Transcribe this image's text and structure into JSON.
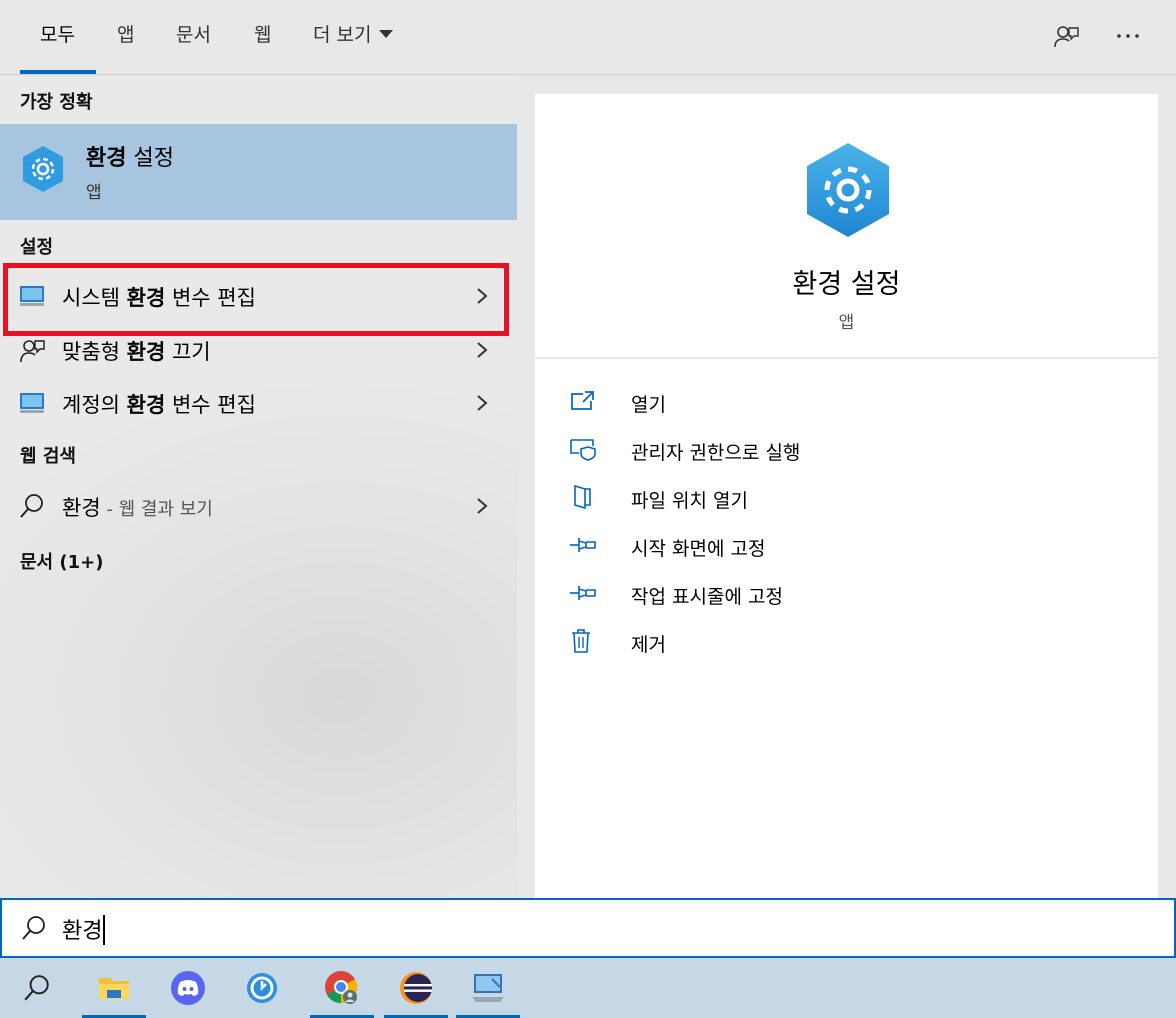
{
  "tabs": [
    "모두",
    "앱",
    "문서",
    "웹",
    "더 보기"
  ],
  "left": {
    "best_match_header": "가장 정확",
    "best_match": {
      "title_bold": "환경",
      "title_rest": " 설정",
      "type": "앱"
    },
    "settings_header": "설정",
    "settings_items": [
      {
        "pre": "시스템 ",
        "bold": "환경",
        "post": " 변수 편집",
        "icon": "monitor-icon"
      },
      {
        "pre": "맞춤형 ",
        "bold": "환경",
        "post": " 끄기",
        "icon": "person-chat-icon"
      },
      {
        "pre": "계정의 ",
        "bold": "환경",
        "post": " 변수 편집",
        "icon": "monitor-icon"
      }
    ],
    "web_header": "웹 검색",
    "web_item": {
      "query": "환경",
      "suffix": " - 웹 결과 보기"
    },
    "docs_header": "문서 (1+)"
  },
  "right": {
    "title": "환경 설정",
    "subtitle": "앱",
    "actions": [
      {
        "label": "열기",
        "icon": "open-icon"
      },
      {
        "label": "관리자 권한으로 실행",
        "icon": "shield-icon"
      },
      {
        "label": "파일 위치 열기",
        "icon": "file-location-icon"
      },
      {
        "label": "시작 화면에 고정",
        "icon": "pin-icon"
      },
      {
        "label": "작업 표시줄에 고정",
        "icon": "pin-icon"
      },
      {
        "label": "제거",
        "icon": "trash-icon"
      }
    ]
  },
  "search": {
    "value": "환경"
  },
  "taskbar": {
    "items": [
      "search-icon",
      "file-explorer-icon",
      "discord-icon",
      "clock-app-icon",
      "chrome-icon",
      "eclipse-icon",
      "network-app-icon"
    ]
  },
  "colors": {
    "accent": "#0067c0",
    "selection": "#a8c5df",
    "highlight_box": "#e81123",
    "taskbar": "#c6d7e6"
  }
}
